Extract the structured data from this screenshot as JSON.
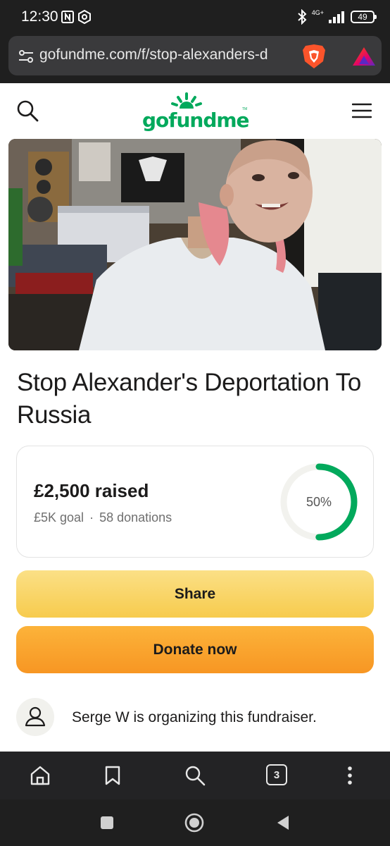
{
  "status_bar": {
    "time": "12:30",
    "network": "4G+",
    "battery": "49"
  },
  "browser": {
    "url": "gofundme.com/f/stop-alexanders-d",
    "tab_count": "3"
  },
  "site": {
    "logo_text": "gofundme",
    "logo_tm": "TM",
    "brand_color": "#02a95c"
  },
  "campaign": {
    "title": "Stop Alexander's Deportation To Russia",
    "raised_amount": "£2,500",
    "raised_suffix": " raised",
    "goal": "£5K goal",
    "separator": "·",
    "donations": "58 donations",
    "progress_percent_label": "50%",
    "progress_fraction": 0.5
  },
  "actions": {
    "share_label": "Share",
    "donate_label": "Donate now"
  },
  "organizer": {
    "text": "Serge W is organizing this fundraiser."
  },
  "icons": {
    "status": [
      "nfc-icon",
      "gear-icon",
      "bluetooth-icon",
      "signal-icon",
      "battery-icon"
    ],
    "browser": [
      "tune-icon",
      "brave-shield-icon",
      "brave-rewards-icon"
    ],
    "site": [
      "search-icon",
      "menu-icon"
    ],
    "toolbar": [
      "home-icon",
      "bookmark-icon",
      "search-icon",
      "tabs-icon",
      "more-icon"
    ],
    "nav": [
      "recents-icon",
      "home-icon",
      "back-icon"
    ]
  }
}
